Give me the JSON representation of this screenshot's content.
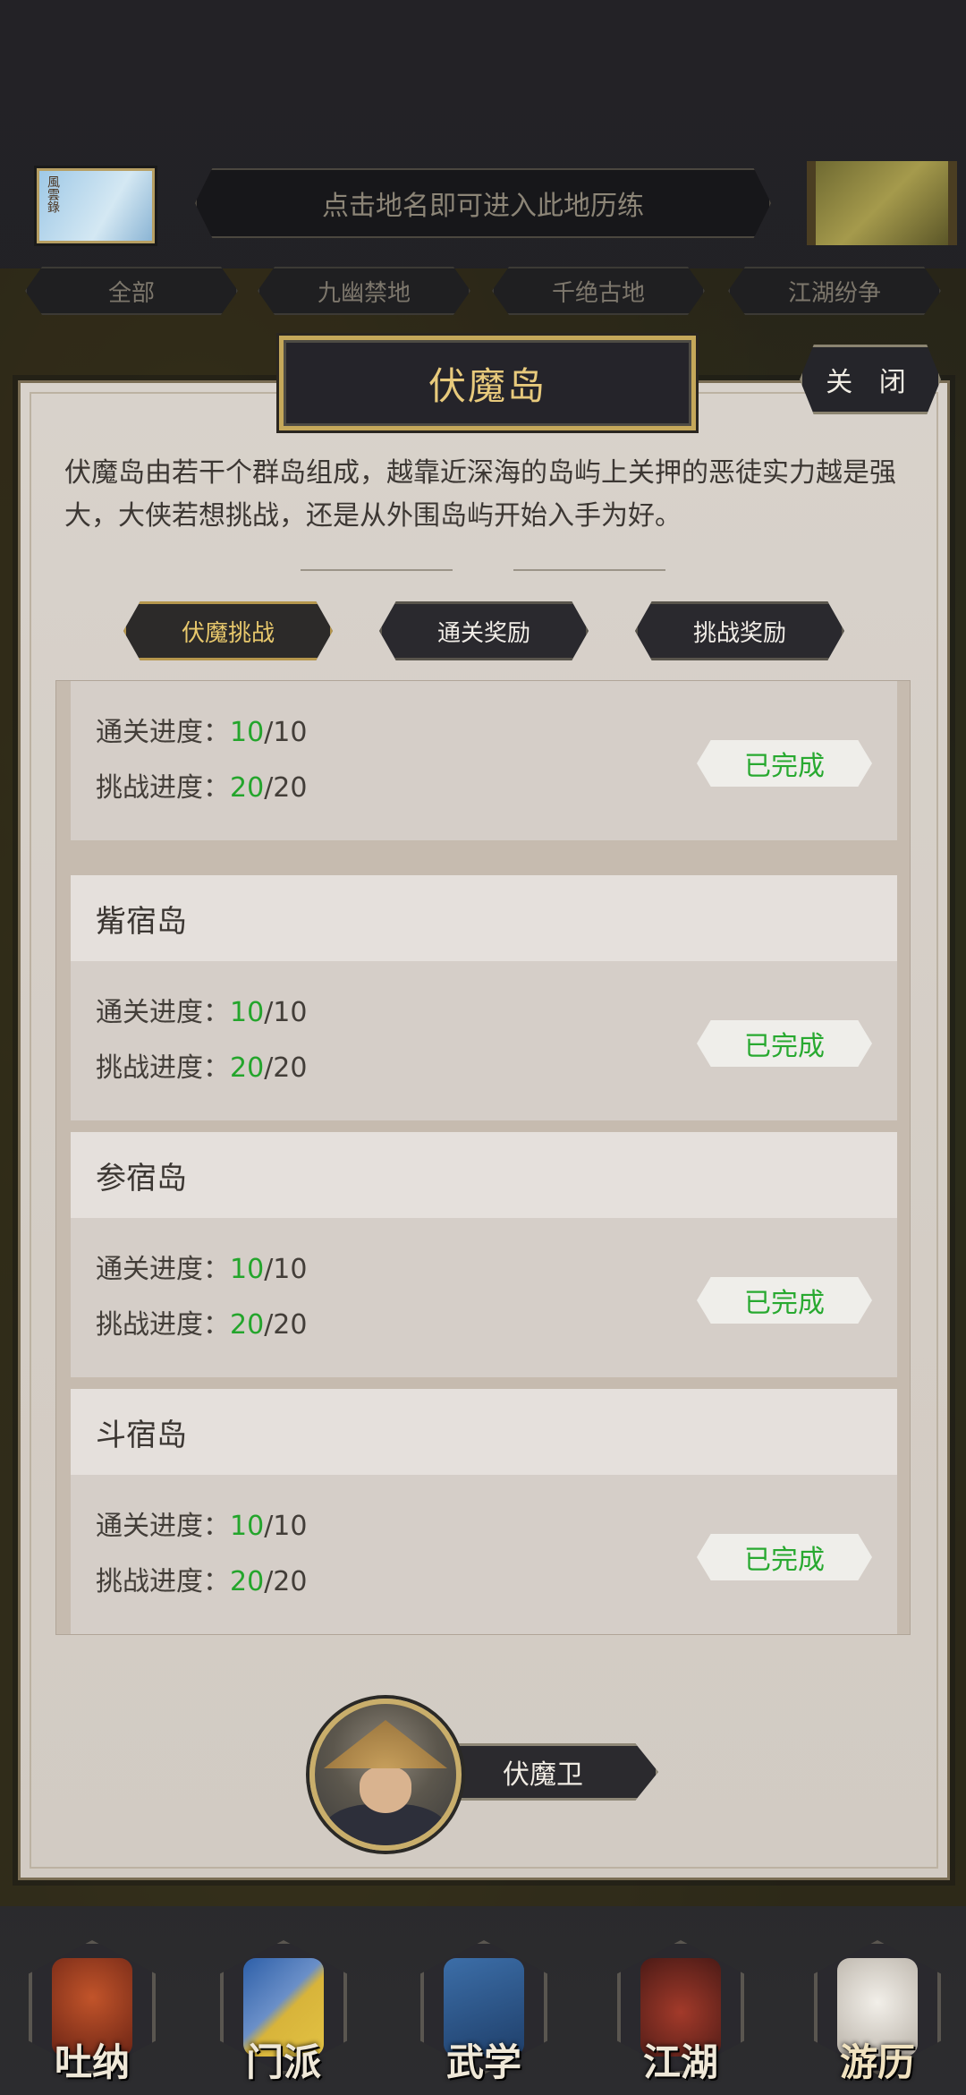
{
  "header": {
    "hint": "点击地名即可进入此地历练",
    "left_scroll_text": "風雲錄",
    "filter_tabs": [
      "全部",
      "九幽禁地",
      "千绝古地",
      "江湖纷争"
    ]
  },
  "dialog": {
    "title": "伏魔岛",
    "close_label": "关 闭",
    "description": "伏魔岛由若干个群岛组成，越靠近深海的岛屿上关押的恶徒实力越是强大，大侠若想挑战，还是从外围岛屿开始入手为好。",
    "tabs": [
      {
        "label": "伏魔挑战",
        "active": true
      },
      {
        "label": "通关奖励",
        "active": false
      },
      {
        "label": "挑战奖励",
        "active": false
      }
    ],
    "progress_labels": {
      "clear": "通关进度：",
      "challenge": "挑战进度："
    },
    "islands": [
      {
        "name": "",
        "clear_cur": "10",
        "clear_total": "/10",
        "challenge_cur": "20",
        "challenge_total": "/20",
        "status": "已完成"
      },
      {
        "name": "觜宿岛",
        "clear_cur": "10",
        "clear_total": "/10",
        "challenge_cur": "20",
        "challenge_total": "/20",
        "status": "已完成"
      },
      {
        "name": "参宿岛",
        "clear_cur": "10",
        "clear_total": "/10",
        "challenge_cur": "20",
        "challenge_total": "/20",
        "status": "已完成"
      },
      {
        "name": "斗宿岛",
        "clear_cur": "10",
        "clear_total": "/10",
        "challenge_cur": "20",
        "challenge_total": "/20",
        "status": "已完成"
      }
    ],
    "guard_label": "伏魔卫"
  },
  "bottom_nav": [
    {
      "label": "吐纳",
      "icon": "meditation-icon"
    },
    {
      "label": "门派",
      "icon": "sect-banner-icon"
    },
    {
      "label": "武学",
      "icon": "martial-book-icon"
    },
    {
      "label": "江湖",
      "icon": "bamboo-hat-icon"
    },
    {
      "label": "游历",
      "icon": "white-horse-icon",
      "active": true
    }
  ],
  "colors": {
    "accent_gold": "#e8ca7c",
    "done_green": "#28a930",
    "progress_green": "#24a52c"
  }
}
